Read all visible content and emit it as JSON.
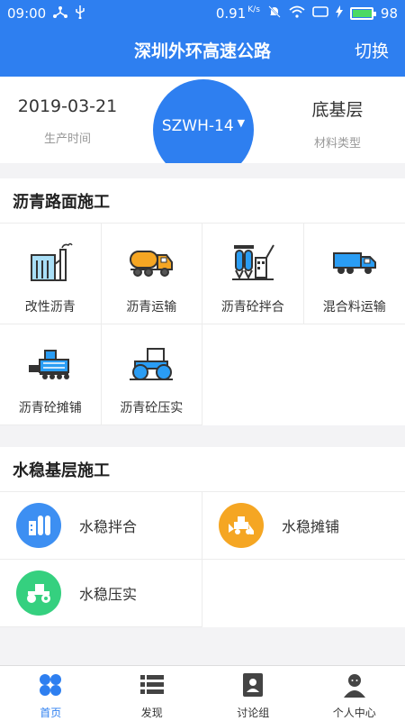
{
  "status_bar": {
    "time": "09:00",
    "speed": "0.91",
    "speed_unit": "K/s",
    "battery": "98",
    "battery_level": 0.98
  },
  "header": {
    "title": "深圳外环高速公路",
    "switch_label": "切换"
  },
  "info": {
    "date_value": "2019-03-21",
    "date_label": "生产时间",
    "project_code": "SZWH-14",
    "material_value": "底基层",
    "material_label": "材料类型"
  },
  "asphalt": {
    "title": "沥青路面施工",
    "items": [
      {
        "label": "改性沥青",
        "icon": "factory-icon"
      },
      {
        "label": "沥青运输",
        "icon": "tanker-truck-icon"
      },
      {
        "label": "沥青砼拌合",
        "icon": "mixing-plant-icon"
      },
      {
        "label": "混合料运输",
        "icon": "dump-truck-icon"
      },
      {
        "label": "沥青砼摊铺",
        "icon": "paver-icon"
      },
      {
        "label": "沥青砼压实",
        "icon": "road-roller-icon"
      }
    ]
  },
  "water": {
    "title": "水稳基层施工",
    "items": [
      {
        "label": "水稳拌合",
        "icon": "mixing-plant-icon",
        "color": "#3d8ff2"
      },
      {
        "label": "水稳摊铺",
        "icon": "bulldozer-icon",
        "color": "#f5a623"
      },
      {
        "label": "水稳压实",
        "icon": "road-roller-icon",
        "color": "#35d07f"
      }
    ]
  },
  "tabs": [
    {
      "label": "首页",
      "icon": "home-grid-icon",
      "active": true
    },
    {
      "label": "发现",
      "icon": "list-icon",
      "active": false
    },
    {
      "label": "讨论组",
      "icon": "contact-card-icon",
      "active": false
    },
    {
      "label": "个人中心",
      "icon": "person-icon",
      "active": false
    }
  ],
  "colors": {
    "primary": "#2e7ff0",
    "icon_blue": "#2a9df4",
    "text_dark": "#333333",
    "text_light": "#999999"
  }
}
